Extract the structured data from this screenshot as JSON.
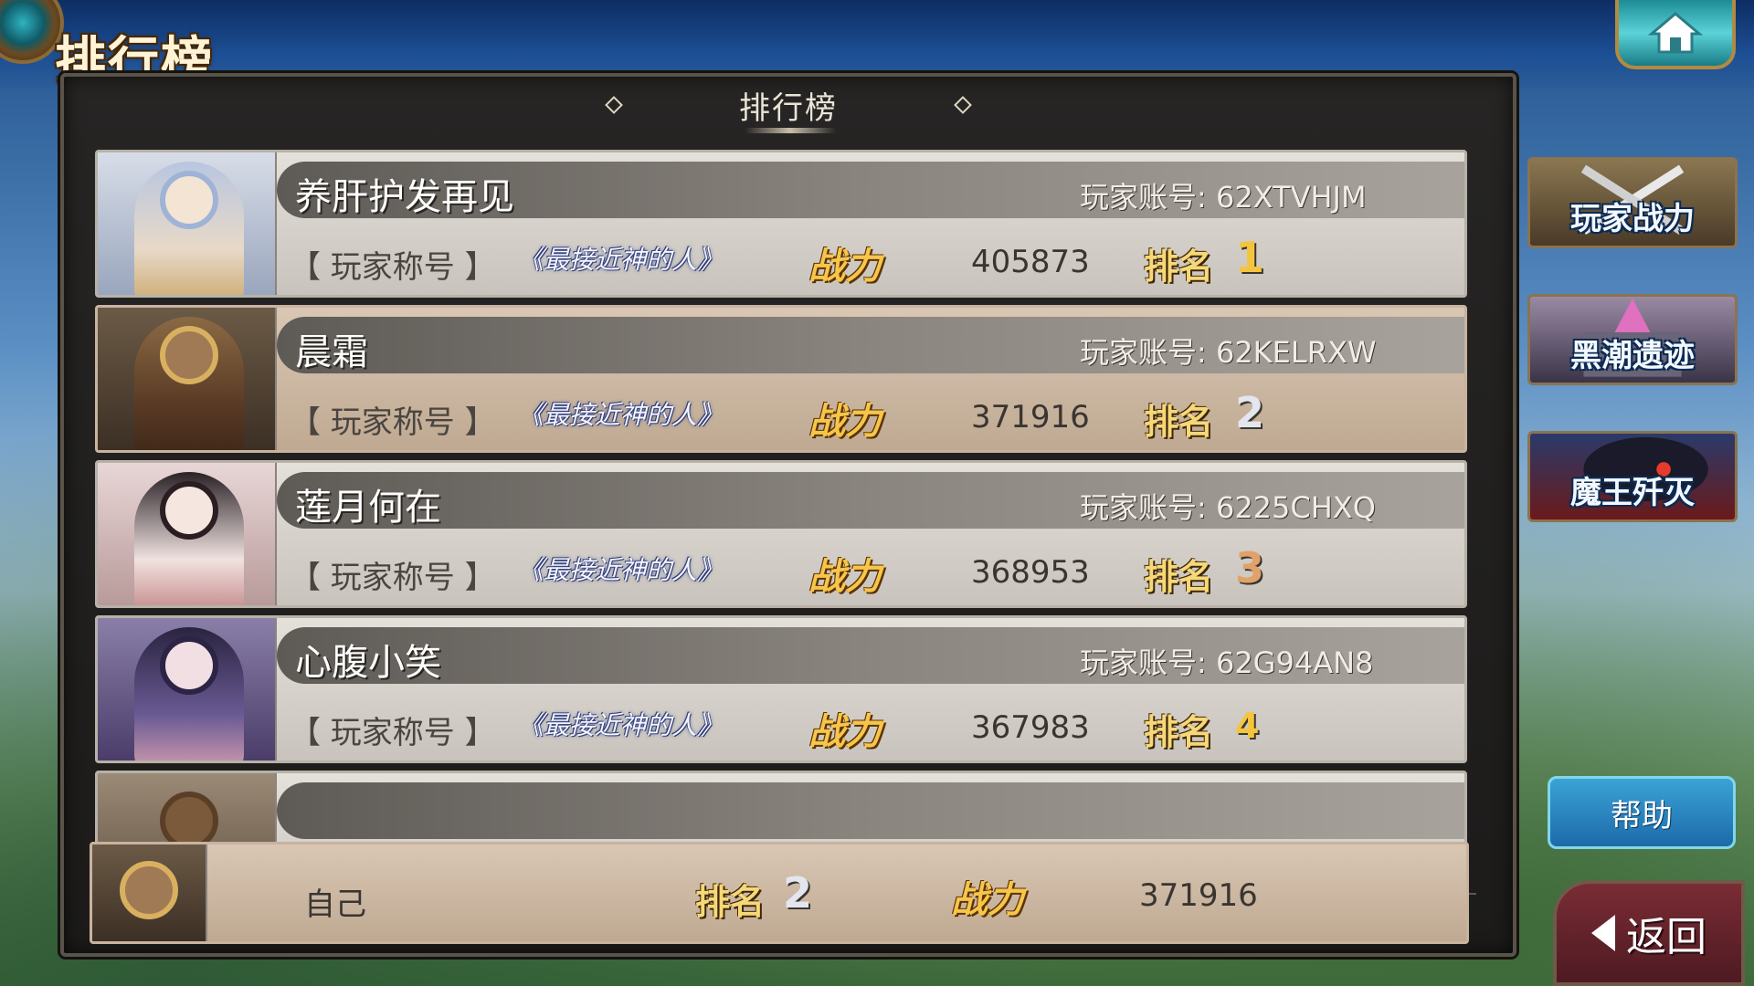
{
  "header": {
    "screen_title": "排行榜",
    "panel_title": "排行榜"
  },
  "rankings": [
    {
      "name": "养肝护发再见",
      "account": "玩家账号: 62XTVHJM",
      "title_label": "【 玩家称号 】",
      "title_badge": "《最接近神的人》",
      "power_label": "战力",
      "power": "405873",
      "rank_label": "排名",
      "rank": "1"
    },
    {
      "name": "晨霜",
      "account": "玩家账号: 62KELRXW",
      "title_label": "【 玩家称号 】",
      "title_badge": "《最接近神的人》",
      "power_label": "战力",
      "power": "371916",
      "rank_label": "排名",
      "rank": "2"
    },
    {
      "name": "莲月何在",
      "account": "玩家账号: 6225CHXQ",
      "title_label": "【 玩家称号 】",
      "title_badge": "《最接近神的人》",
      "power_label": "战力",
      "power": "368953",
      "rank_label": "排名",
      "rank": "3"
    },
    {
      "name": "心腹小笑",
      "account": "玩家账号: 62G94AN8",
      "title_label": "【 玩家称号 】",
      "title_badge": "《最接近神的人》",
      "power_label": "战力",
      "power": "367983",
      "rank_label": "排名",
      "rank": "4"
    }
  ],
  "self": {
    "label": "自己",
    "rank_label": "排名",
    "rank": "2",
    "power_label": "战力",
    "power": "371916"
  },
  "side_menu": {
    "player_power": "玩家战力",
    "dark_tide_ruins": "黑潮遗迹",
    "demon_king": "魔王歼灭"
  },
  "buttons": {
    "help": "帮助",
    "back": "返回"
  },
  "icons": {
    "home": "home-icon",
    "back": "back-arrow-icon"
  },
  "colors": {
    "power_gold": "#f7c54a",
    "panel_dark": "#1c1b1a",
    "row_light": "#e4e0da",
    "row_highlight": "#d9c7b4"
  }
}
